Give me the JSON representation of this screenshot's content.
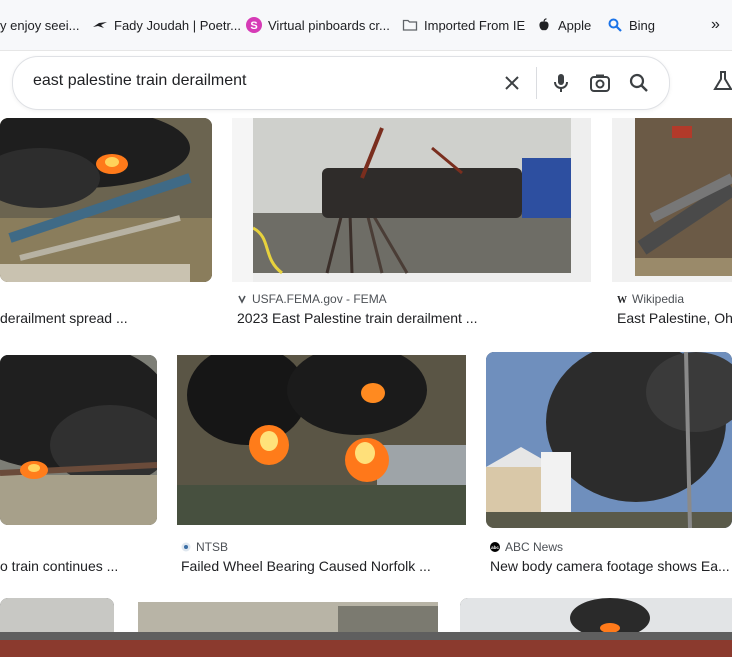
{
  "bookmarks": [
    {
      "label": "y enjoy seei...",
      "icon": "bookmark-icon"
    },
    {
      "label": "Fady Joudah | Poetr...",
      "icon": "bird-icon"
    },
    {
      "label": "Virtual pinboards cr...",
      "icon": "pinboard-s-icon"
    },
    {
      "label": "Imported From IE",
      "icon": "folder-icon"
    },
    {
      "label": "Apple",
      "icon": "apple-icon"
    },
    {
      "label": "Bing",
      "icon": "bing-search-icon"
    }
  ],
  "bookmarks_more": "»",
  "search": {
    "query": "east palestine train derailment"
  },
  "results": [
    {
      "source": "",
      "caption": "derailment spread ..."
    },
    {
      "source": "USFA.FEMA.gov - FEMA",
      "caption": "2023 East Palestine train derailment ..."
    },
    {
      "source": "Wikipedia",
      "caption": "East Palestine, Oh"
    },
    {
      "source": "",
      "caption": "o train continues ..."
    },
    {
      "source": "NTSB",
      "caption": "Failed Wheel Bearing Caused Norfolk ..."
    },
    {
      "source": "ABC News",
      "caption": "New body camera footage shows Ea..."
    }
  ],
  "colors": {
    "accent": "#1a73e8",
    "smoke": "#2b2b2b",
    "fire": "#ff8a1a"
  }
}
